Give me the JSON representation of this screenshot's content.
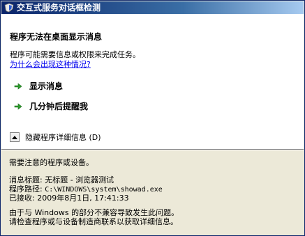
{
  "window": {
    "title": "交互式服务对话框检测",
    "icon": "warning-shield-icon"
  },
  "main": {
    "heading": "程序无法在桌面显示消息",
    "description": "程序可能需要信息或权限来完成任务。",
    "help_link": "为什么会出现这种情况?",
    "actions": [
      {
        "label": "显示消息",
        "icon": "green-arrow-icon"
      },
      {
        "label": "几分钟后提醒我",
        "icon": "green-arrow-icon"
      }
    ],
    "details_toggle": "隐藏程序详细信息 (D)"
  },
  "details": {
    "notice": "需要注意的程序或设备。",
    "message_title_label": "消息标题: ",
    "message_title_value": "无标题 - 浏览器测试",
    "program_path_label": "程序路径: ",
    "program_path_value": "C:\\WINDOWS\\system\\showad.exe",
    "received_label": "已接收: ",
    "received_value": "2009年8月1日, 17:41:33",
    "footer_line1": "由于与 Windows 的部分不兼容导致发生此问题。",
    "footer_line2": "请检查程序或与设备制造商联系以获取详细信息。"
  },
  "colors": {
    "title_start": "#0a246a",
    "title_end": "#a6caf0",
    "link": "#0000ee",
    "arrow": "#2e9e2e"
  }
}
